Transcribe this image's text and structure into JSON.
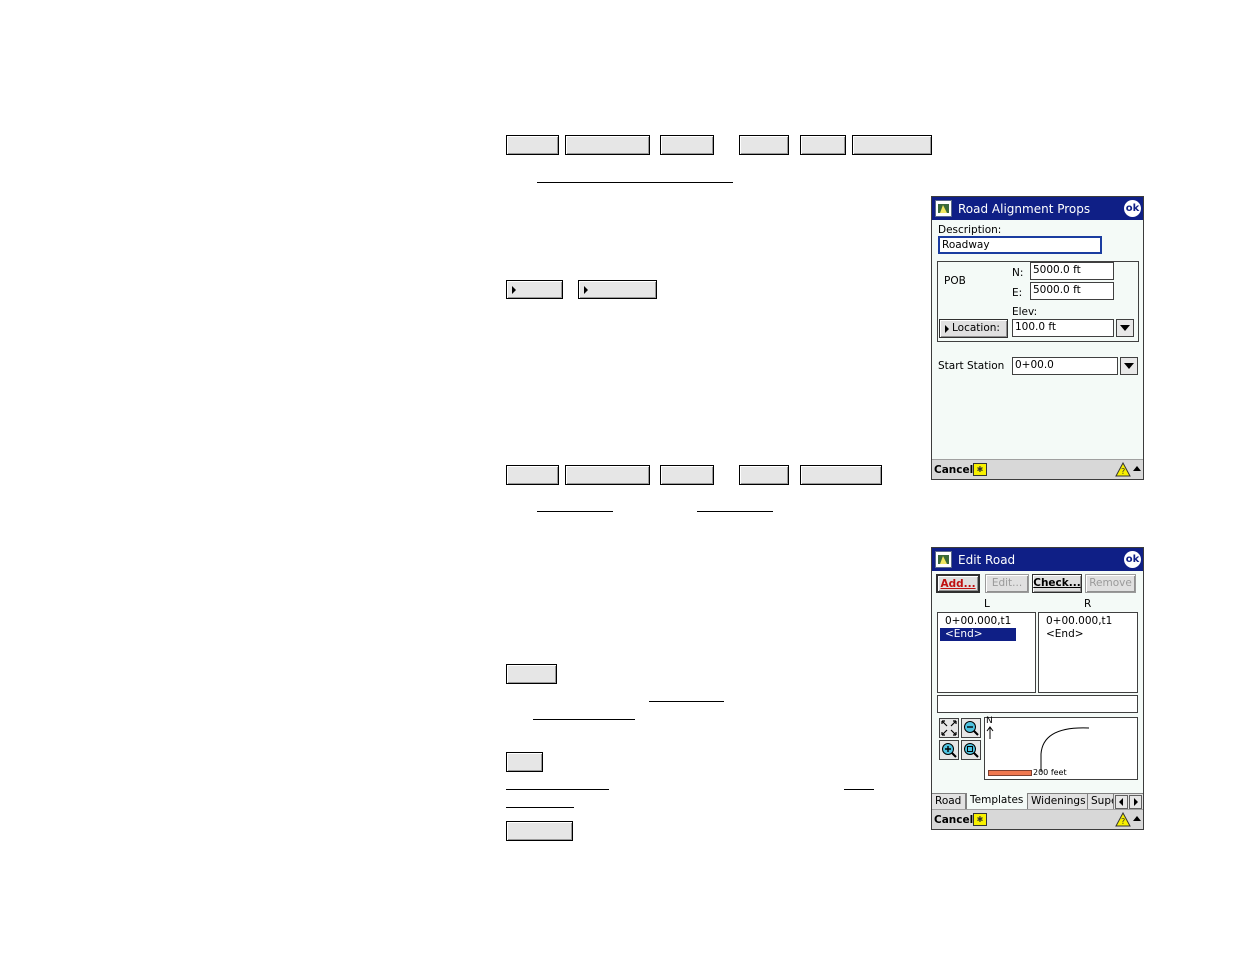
{
  "screen1": {
    "title": "Road Alignment Props",
    "ok_label": "ok",
    "description_label": "Description:",
    "description_value": "Roadway",
    "pob_label": "POB",
    "n_label": "N:",
    "n_value": "5000.0 ft",
    "e_label": "E:",
    "e_value": "5000.0 ft",
    "elev_label": "Elev:",
    "elev_value": "100.0 ft",
    "location_button": "Location:",
    "start_station_label": "Start Station",
    "start_station_value": "0+00.0",
    "cancel_label": "Cancel"
  },
  "screen2": {
    "title": "Edit Road",
    "ok_label": "ok",
    "buttons": {
      "add": "Add...",
      "edit": "Edit...",
      "check": "Check...",
      "remove": "Remove"
    },
    "left_header": "L",
    "right_header": "R",
    "left_items": [
      "0+00.000,t1",
      "<End>"
    ],
    "right_items": [
      "0+00.000,t1",
      "<End>"
    ],
    "north_label": "N",
    "scale_label": "200 feet",
    "tabs": [
      "Road",
      "Templates",
      "Widenings",
      "Supe"
    ],
    "active_tab": "Templates",
    "cancel_label": "Cancel"
  },
  "colors": {
    "titlebar": "#0f1f86",
    "screen_bg": "#f4faf7",
    "scale_bar": "#f07850",
    "add_button_text": "#c01010"
  }
}
